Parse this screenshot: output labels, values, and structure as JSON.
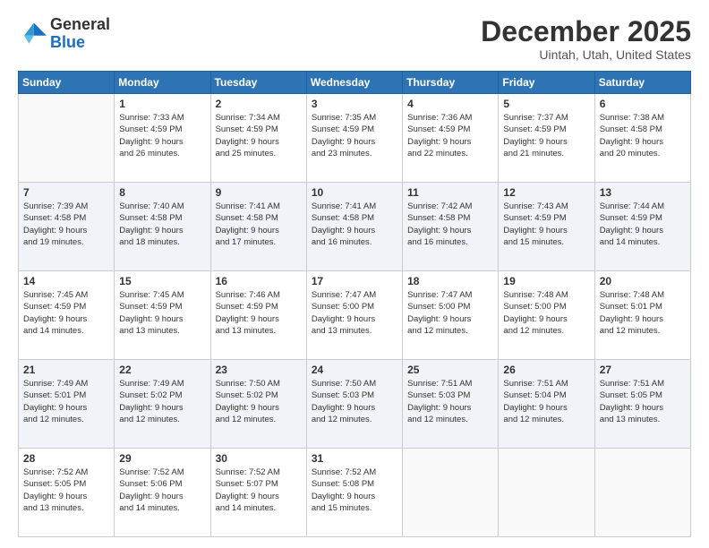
{
  "logo": {
    "line1": "General",
    "line2": "Blue"
  },
  "header": {
    "month": "December 2025",
    "location": "Uintah, Utah, United States"
  },
  "weekdays": [
    "Sunday",
    "Monday",
    "Tuesday",
    "Wednesday",
    "Thursday",
    "Friday",
    "Saturday"
  ],
  "weeks": [
    [
      {
        "day": "",
        "info": ""
      },
      {
        "day": "1",
        "info": "Sunrise: 7:33 AM\nSunset: 4:59 PM\nDaylight: 9 hours\nand 26 minutes."
      },
      {
        "day": "2",
        "info": "Sunrise: 7:34 AM\nSunset: 4:59 PM\nDaylight: 9 hours\nand 25 minutes."
      },
      {
        "day": "3",
        "info": "Sunrise: 7:35 AM\nSunset: 4:59 PM\nDaylight: 9 hours\nand 23 minutes."
      },
      {
        "day": "4",
        "info": "Sunrise: 7:36 AM\nSunset: 4:59 PM\nDaylight: 9 hours\nand 22 minutes."
      },
      {
        "day": "5",
        "info": "Sunrise: 7:37 AM\nSunset: 4:59 PM\nDaylight: 9 hours\nand 21 minutes."
      },
      {
        "day": "6",
        "info": "Sunrise: 7:38 AM\nSunset: 4:58 PM\nDaylight: 9 hours\nand 20 minutes."
      }
    ],
    [
      {
        "day": "7",
        "info": "Sunrise: 7:39 AM\nSunset: 4:58 PM\nDaylight: 9 hours\nand 19 minutes."
      },
      {
        "day": "8",
        "info": "Sunrise: 7:40 AM\nSunset: 4:58 PM\nDaylight: 9 hours\nand 18 minutes."
      },
      {
        "day": "9",
        "info": "Sunrise: 7:41 AM\nSunset: 4:58 PM\nDaylight: 9 hours\nand 17 minutes."
      },
      {
        "day": "10",
        "info": "Sunrise: 7:41 AM\nSunset: 4:58 PM\nDaylight: 9 hours\nand 16 minutes."
      },
      {
        "day": "11",
        "info": "Sunrise: 7:42 AM\nSunset: 4:58 PM\nDaylight: 9 hours\nand 16 minutes."
      },
      {
        "day": "12",
        "info": "Sunrise: 7:43 AM\nSunset: 4:59 PM\nDaylight: 9 hours\nand 15 minutes."
      },
      {
        "day": "13",
        "info": "Sunrise: 7:44 AM\nSunset: 4:59 PM\nDaylight: 9 hours\nand 14 minutes."
      }
    ],
    [
      {
        "day": "14",
        "info": "Sunrise: 7:45 AM\nSunset: 4:59 PM\nDaylight: 9 hours\nand 14 minutes."
      },
      {
        "day": "15",
        "info": "Sunrise: 7:45 AM\nSunset: 4:59 PM\nDaylight: 9 hours\nand 13 minutes."
      },
      {
        "day": "16",
        "info": "Sunrise: 7:46 AM\nSunset: 4:59 PM\nDaylight: 9 hours\nand 13 minutes."
      },
      {
        "day": "17",
        "info": "Sunrise: 7:47 AM\nSunset: 5:00 PM\nDaylight: 9 hours\nand 13 minutes."
      },
      {
        "day": "18",
        "info": "Sunrise: 7:47 AM\nSunset: 5:00 PM\nDaylight: 9 hours\nand 12 minutes."
      },
      {
        "day": "19",
        "info": "Sunrise: 7:48 AM\nSunset: 5:00 PM\nDaylight: 9 hours\nand 12 minutes."
      },
      {
        "day": "20",
        "info": "Sunrise: 7:48 AM\nSunset: 5:01 PM\nDaylight: 9 hours\nand 12 minutes."
      }
    ],
    [
      {
        "day": "21",
        "info": "Sunrise: 7:49 AM\nSunset: 5:01 PM\nDaylight: 9 hours\nand 12 minutes."
      },
      {
        "day": "22",
        "info": "Sunrise: 7:49 AM\nSunset: 5:02 PM\nDaylight: 9 hours\nand 12 minutes."
      },
      {
        "day": "23",
        "info": "Sunrise: 7:50 AM\nSunset: 5:02 PM\nDaylight: 9 hours\nand 12 minutes."
      },
      {
        "day": "24",
        "info": "Sunrise: 7:50 AM\nSunset: 5:03 PM\nDaylight: 9 hours\nand 12 minutes."
      },
      {
        "day": "25",
        "info": "Sunrise: 7:51 AM\nSunset: 5:03 PM\nDaylight: 9 hours\nand 12 minutes."
      },
      {
        "day": "26",
        "info": "Sunrise: 7:51 AM\nSunset: 5:04 PM\nDaylight: 9 hours\nand 12 minutes."
      },
      {
        "day": "27",
        "info": "Sunrise: 7:51 AM\nSunset: 5:05 PM\nDaylight: 9 hours\nand 13 minutes."
      }
    ],
    [
      {
        "day": "28",
        "info": "Sunrise: 7:52 AM\nSunset: 5:05 PM\nDaylight: 9 hours\nand 13 minutes."
      },
      {
        "day": "29",
        "info": "Sunrise: 7:52 AM\nSunset: 5:06 PM\nDaylight: 9 hours\nand 14 minutes."
      },
      {
        "day": "30",
        "info": "Sunrise: 7:52 AM\nSunset: 5:07 PM\nDaylight: 9 hours\nand 14 minutes."
      },
      {
        "day": "31",
        "info": "Sunrise: 7:52 AM\nSunset: 5:08 PM\nDaylight: 9 hours\nand 15 minutes."
      },
      {
        "day": "",
        "info": ""
      },
      {
        "day": "",
        "info": ""
      },
      {
        "day": "",
        "info": ""
      }
    ]
  ]
}
